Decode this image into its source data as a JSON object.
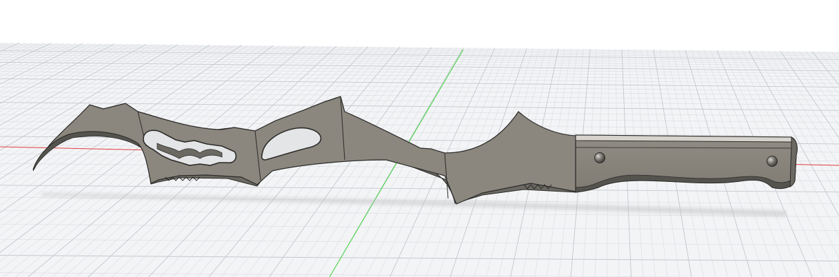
{
  "viewport": {
    "view": "perspective",
    "grid": true,
    "axes": [
      "x-axis",
      "y-axis"
    ]
  },
  "colors": {
    "background": "#ffffff",
    "ground_plane": "#f3f4f6",
    "grid_minor": "#d9dce1",
    "grid_major": "#c3c7cd",
    "x_axis": "#e23b3b",
    "y_axis": "#3ed63e",
    "body_fill": "#8b877e",
    "body_edge": "#2b2a28",
    "bevel": "#6c6962",
    "shadow": "#bdbdbd"
  },
  "model": {
    "type": "blade",
    "parts": [
      "blade",
      "handle",
      "handle-pin-left",
      "handle-pin-right"
    ]
  }
}
